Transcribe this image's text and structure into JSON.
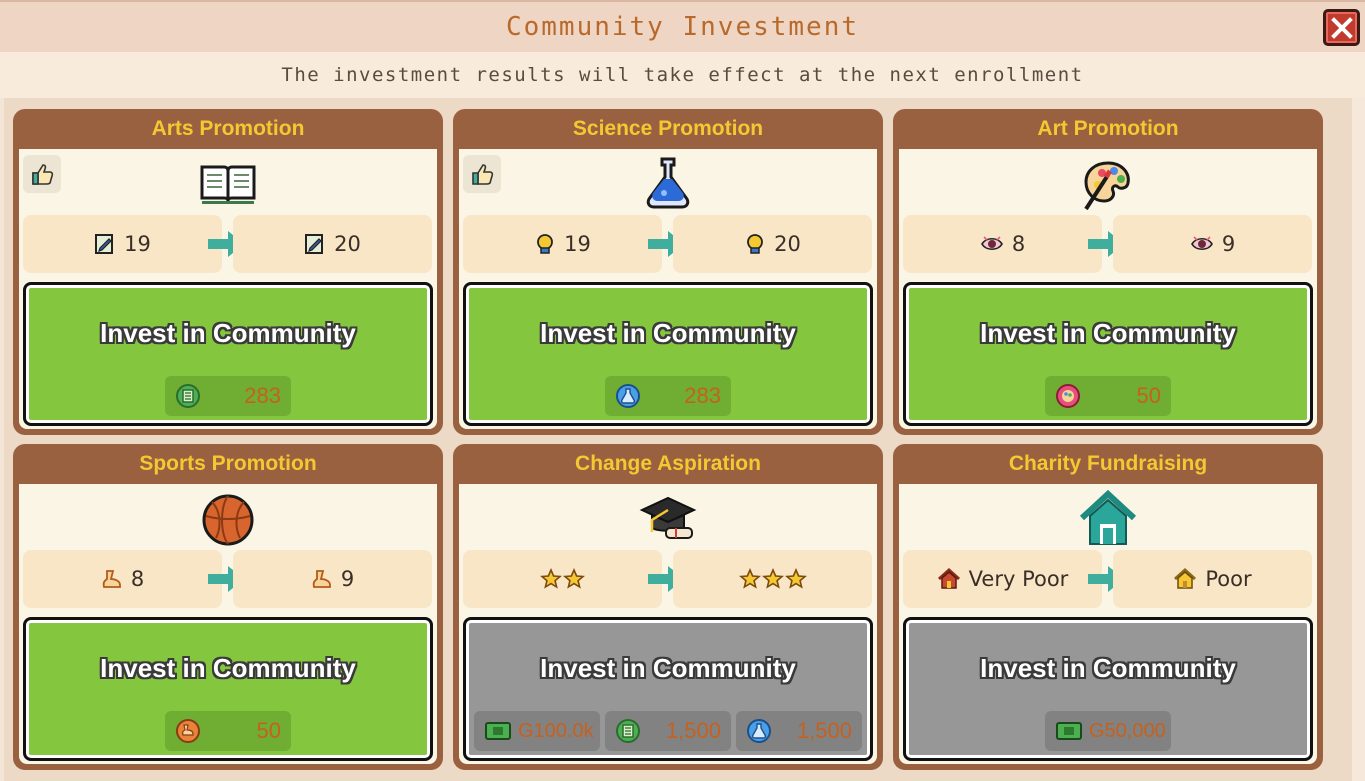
{
  "window": {
    "title": "Community Investment",
    "subtitle": "The investment results will take effect at the next enrollment",
    "close_icon": "close-x-icon"
  },
  "cards": [
    {
      "title": "Arts Promotion",
      "has_thumb": true,
      "icon": "open-book-icon",
      "stat_icon": "pencil-paper-icon",
      "from": "19",
      "to": "20",
      "button": "Invest in Community",
      "enabled": true,
      "costs": [
        {
          "icon": "green-book-coin-icon",
          "value": "283"
        }
      ]
    },
    {
      "title": "Science Promotion",
      "has_thumb": true,
      "icon": "flask-icon",
      "stat_icon": "lightbulb-icon",
      "from": "19",
      "to": "20",
      "button": "Invest in Community",
      "enabled": true,
      "costs": [
        {
          "icon": "blue-flask-coin-icon",
          "value": "283"
        }
      ]
    },
    {
      "title": "Art Promotion",
      "has_thumb": false,
      "icon": "paint-palette-icon",
      "stat_icon": "eye-icon",
      "from": "8",
      "to": "9",
      "button": "Invest in Community",
      "enabled": true,
      "costs": [
        {
          "icon": "pink-palette-coin-icon",
          "value": "50"
        }
      ]
    },
    {
      "title": "Sports Promotion",
      "has_thumb": false,
      "icon": "basketball-icon",
      "stat_icon": "running-foot-icon",
      "from": "8",
      "to": "9",
      "button": "Invest in Community",
      "enabled": true,
      "costs": [
        {
          "icon": "orange-sports-coin-icon",
          "value": "50"
        }
      ]
    },
    {
      "title": "Change Aspiration",
      "has_thumb": false,
      "icon": "graduation-cap-icon",
      "stat_icon": "star-icon",
      "from_stars": 2,
      "to_stars": 3,
      "button": "Invest in Community",
      "enabled": false,
      "costs": [
        {
          "icon": "cash-icon",
          "value": "G100.0k"
        },
        {
          "icon": "green-book-coin-icon",
          "value": "1,500"
        },
        {
          "icon": "blue-flask-coin-icon",
          "value": "1,500"
        }
      ]
    },
    {
      "title": "Charity Fundraising",
      "has_thumb": false,
      "icon": "house-icon",
      "stat_icon": "house-small-icon",
      "from": "Very Poor",
      "to": "Poor",
      "button": "Invest in Community",
      "enabled": false,
      "costs": [
        {
          "icon": "cash-icon",
          "value": "G50,000"
        }
      ]
    }
  ],
  "colors": {
    "card_frame": "#9a6140",
    "title_gold": "#f5c832",
    "enabled_button": "#84c63e",
    "disabled_button": "#979797",
    "cost_text": "#c5611f",
    "arrow": "#3fae9c"
  }
}
